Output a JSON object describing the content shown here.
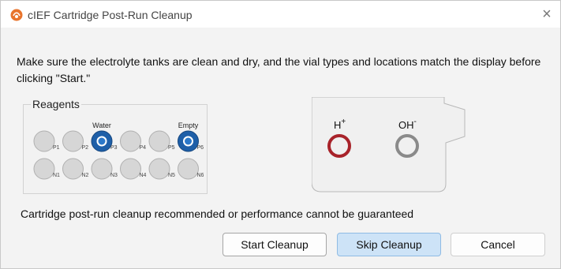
{
  "window": {
    "title": "cIEF Cartridge Post-Run Cleanup",
    "close_glyph": "×",
    "icon": "app-logo-icon"
  },
  "instructions": "Make sure the electrolyte tanks are clean and dry, and the vial types and locations match the display before clicking \"Start.\"",
  "reagents": {
    "title": "Reagents",
    "top_row": [
      {
        "id": "P1",
        "label": "",
        "filled": false
      },
      {
        "id": "P2",
        "label": "",
        "filled": false
      },
      {
        "id": "P3",
        "label": "Water",
        "filled": true
      },
      {
        "id": "P4",
        "label": "",
        "filled": false
      },
      {
        "id": "P5",
        "label": "",
        "filled": false
      },
      {
        "id": "P6",
        "label": "Empty",
        "filled": true
      }
    ],
    "bottom_row": [
      {
        "id": "N1"
      },
      {
        "id": "N2"
      },
      {
        "id": "N3"
      },
      {
        "id": "N4"
      },
      {
        "id": "N5"
      },
      {
        "id": "N6"
      }
    ]
  },
  "cartridge": {
    "anode_label": "H",
    "anode_sup": "+",
    "cathode_label": "OH",
    "cathode_sup": "-",
    "anode_color": "#a8232a",
    "cathode_color": "#8a8a8a"
  },
  "warning": "Cartridge post-run cleanup recommended or performance cannot be guaranteed",
  "buttons": {
    "start": "Start Cleanup",
    "skip": "Skip Cleanup",
    "cancel": "Cancel"
  },
  "colors": {
    "vial_filled": "#1e5fa8",
    "vial_empty": "#d6d6d6",
    "skip_button_bg": "#cde3f7"
  }
}
